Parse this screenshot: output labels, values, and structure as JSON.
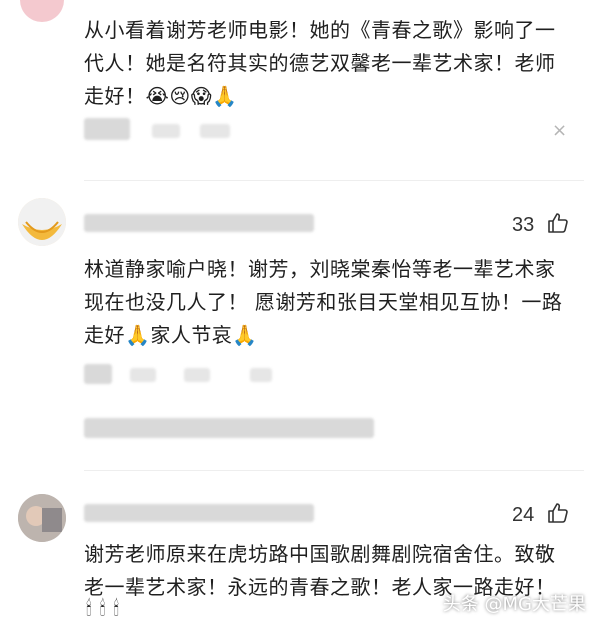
{
  "comments": [
    {
      "text_lines": [
        "从小看着谢芳老师电影！她的《青春之歌》影响了一",
        "代人！她是名符其实的德艺双馨老一辈艺术家！老师",
        "走好！"
      ],
      "emojis": [
        "😭",
        "😢",
        "😱",
        "🙏"
      ]
    },
    {
      "like_count": "33",
      "text_lines": [
        "林道静家喻户晓！谢芳，刘晓棠秦怡等老一辈艺术家",
        "现在也没几人了！ 愿谢芳和张目天堂相见互协！一路",
        "走好"
      ],
      "inline_emoji_1": "🙏",
      "text_after_emoji": "家人节哀",
      "inline_emoji_2": "🙏"
    },
    {
      "like_count": "24",
      "text_lines": [
        "谢芳老师原来在虎坊路中国歌剧舞剧院宿舍住。致敬",
        "老一辈艺术家！永远的青春之歌！老人家一路走好！"
      ],
      "emojis": [
        "🕯",
        "🕯",
        "🕯"
      ]
    }
  ],
  "close_symbol": "×",
  "watermark": "头条 @MG大芒果",
  "colors": {
    "text": "#1f1f1f",
    "blur": "#d9d9d9",
    "icon": "#333333"
  }
}
